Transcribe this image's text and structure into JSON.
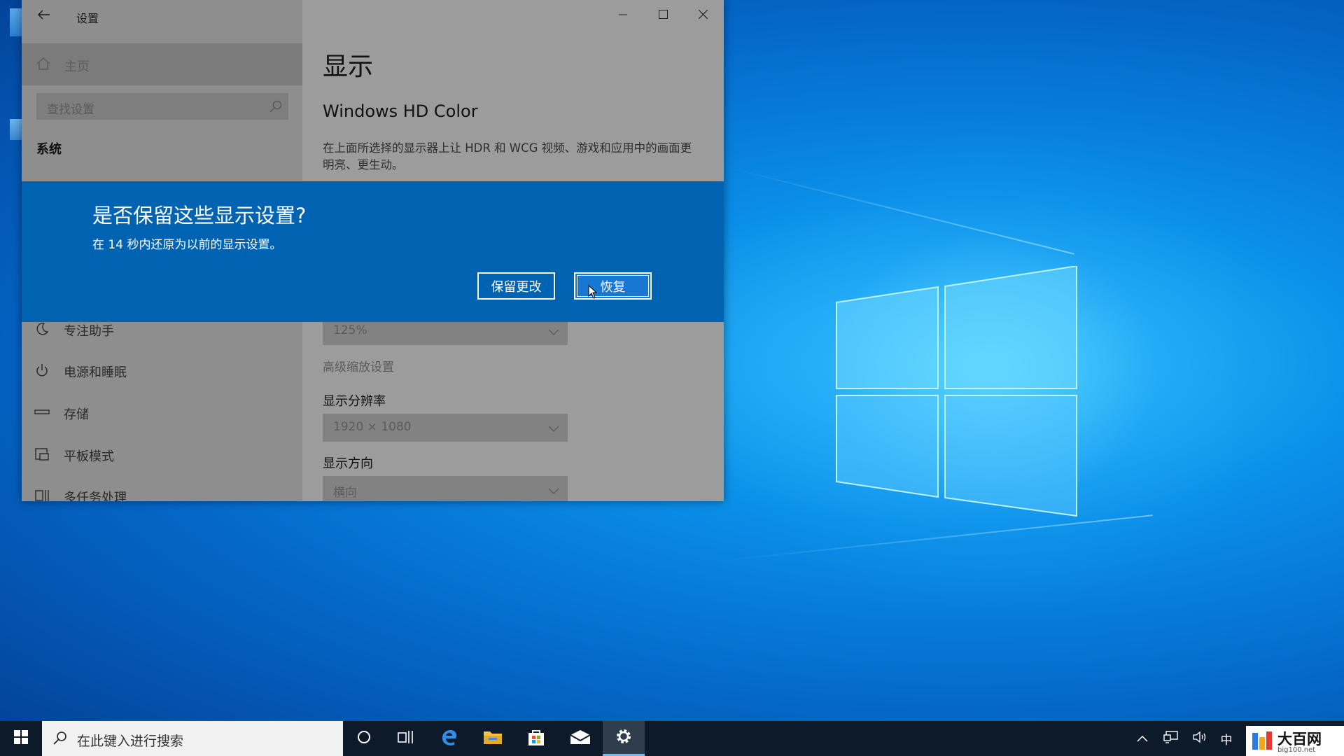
{
  "window": {
    "title": "设置",
    "sidebar": {
      "home_label": "主页",
      "search_placeholder": "查找设置",
      "section_title": "系统",
      "items": [
        {
          "label": "专注助手",
          "icon": "moon-icon"
        },
        {
          "label": "电源和睡眠",
          "icon": "power-icon"
        },
        {
          "label": "存储",
          "icon": "storage-icon"
        },
        {
          "label": "平板模式",
          "icon": "tablet-icon"
        },
        {
          "label": "多任务处理",
          "icon": "multitask-icon"
        }
      ]
    },
    "content": {
      "title": "显示",
      "subtitle": "Windows HD Color",
      "description": "在上面所选择的显示器上让 HDR 和 WCG 视频、游戏和应用中的画面更明亮、更生动。",
      "scale_value": "125%",
      "advanced_scaling_link": "高级缩放设置",
      "resolution_label": "显示分辨率",
      "resolution_value": "1920 × 1080",
      "orientation_label": "显示方向",
      "orientation_value": "横向"
    }
  },
  "dialog": {
    "title": "是否保留这些显示设置?",
    "message": "在 14 秒内还原为以前的显示设置。",
    "keep_label": "保留更改",
    "revert_label": "恢复"
  },
  "taskbar": {
    "search_placeholder": "在此键入进行搜索",
    "ime_indicator": "中"
  },
  "watermark": {
    "text": "大百网",
    "url": "big100.net"
  },
  "colors": {
    "dialog_blue": "#0063b1",
    "taskbar": "#0d1a29",
    "accent": "#76b9ed"
  }
}
